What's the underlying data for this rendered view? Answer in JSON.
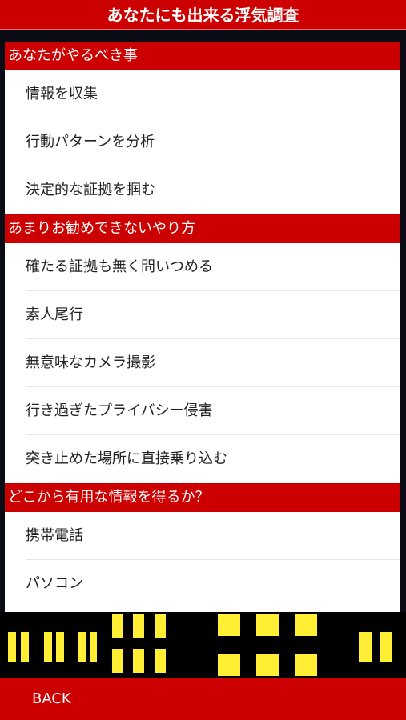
{
  "header": {
    "title": "あなたにも出来る浮気調査"
  },
  "sections": [
    {
      "title": "あなたがやるべき事",
      "items": [
        "情報を収集",
        "行動パターンを分析",
        "決定的な証拠を掴む"
      ]
    },
    {
      "title": "あまりお勧めできないやり方",
      "items": [
        "確たる証拠も無く問いつめる",
        "素人尾行",
        "無意味なカメラ撮影",
        "行き過ぎたプライバシー侵害",
        "突き止めた場所に直接乗り込む"
      ]
    },
    {
      "title": "どこから有用な情報を得るか？",
      "items": [
        "携帯電話",
        "パソコン"
      ]
    }
  ],
  "footer": {
    "back_label": "BACK"
  },
  "colors": {
    "accent": "#cc0000",
    "window_light": "#ffee33"
  }
}
